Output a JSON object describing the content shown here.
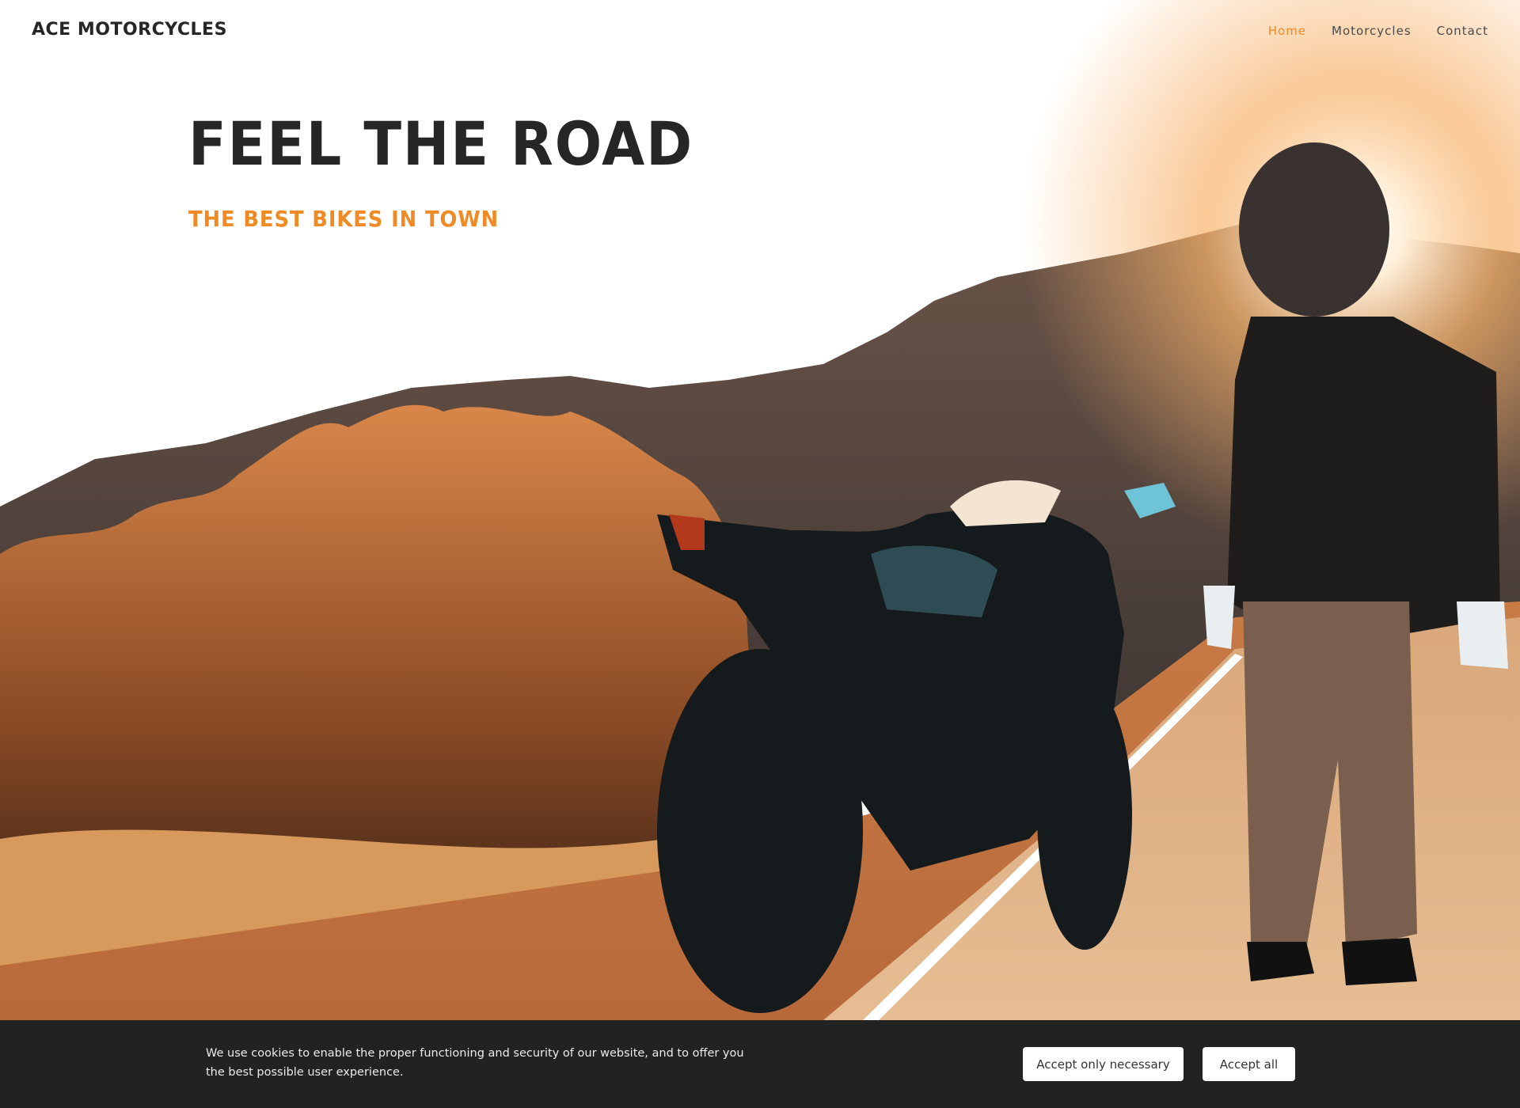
{
  "header": {
    "brand": "ACE MOTORCYCLES",
    "nav": [
      {
        "label": "Home",
        "active": true
      },
      {
        "label": "Motorcycles",
        "active": false
      },
      {
        "label": "Contact",
        "active": false
      }
    ]
  },
  "hero": {
    "title": "FEEL THE ROAD",
    "subtitle": "THE BEST BIKES IN TOWN",
    "image_description": "Rider in helmet standing beside a black sport motorcycle on a desert road at sunset with orange shrubs and mountains"
  },
  "cookie_banner": {
    "message": "We use cookies to enable the proper functioning and security of our website, and to offer you the best possible user experience.",
    "buttons": {
      "necessary": "Accept only necessary",
      "all": "Accept all"
    }
  },
  "colors": {
    "accent": "#f08a24",
    "text_dark": "#262626",
    "banner_bg": "#222222"
  }
}
